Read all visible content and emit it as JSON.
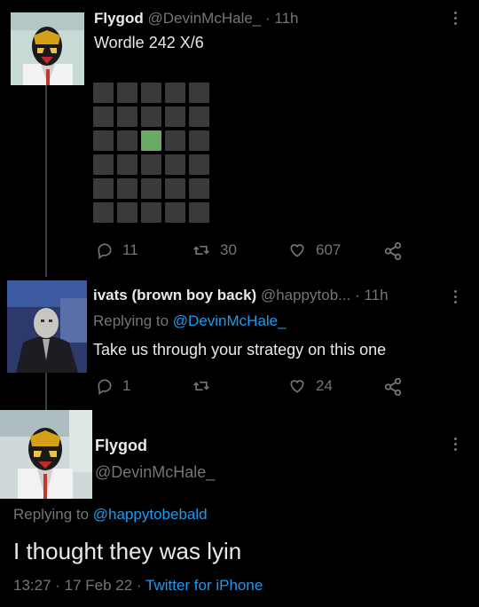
{
  "tweet1": {
    "display_name": "Flygod",
    "handle": "@DevinMcHale_",
    "time": "· 11h",
    "text": "Wordle 242 X/6",
    "wordle_grid": [
      [
        "absent",
        "absent",
        "absent",
        "absent",
        "absent"
      ],
      [
        "absent",
        "absent",
        "absent",
        "absent",
        "absent"
      ],
      [
        "absent",
        "absent",
        "correct",
        "absent",
        "absent"
      ],
      [
        "absent",
        "absent",
        "absent",
        "absent",
        "absent"
      ],
      [
        "absent",
        "absent",
        "absent",
        "absent",
        "absent"
      ],
      [
        "absent",
        "absent",
        "absent",
        "absent",
        "absent"
      ]
    ],
    "replies": "11",
    "retweets": "30",
    "likes": "607"
  },
  "tweet2": {
    "display_name": "ivats (brown boy back)",
    "handle": "@happytob...",
    "time": "· 11h",
    "replying_prefix": "Replying to ",
    "replying_handle": "@DevinMcHale_",
    "text": "Take us through your strategy on this one",
    "replies": "1",
    "retweets": "",
    "likes": "24"
  },
  "tweet3": {
    "display_name": "Flygod",
    "handle": "@DevinMcHale_",
    "replying_prefix": "Replying to ",
    "replying_handle": "@happytobebald",
    "text": "I thought they was lyin",
    "timestamp": "13:27 · 17 Feb 22 · ",
    "source": "Twitter for iPhone"
  },
  "colors": {
    "background": "#000000",
    "accent": "#1d9bf0",
    "muted": "#71767b",
    "wordle_correct": "#6aaa64",
    "wordle_absent": "#3a3a3c"
  }
}
